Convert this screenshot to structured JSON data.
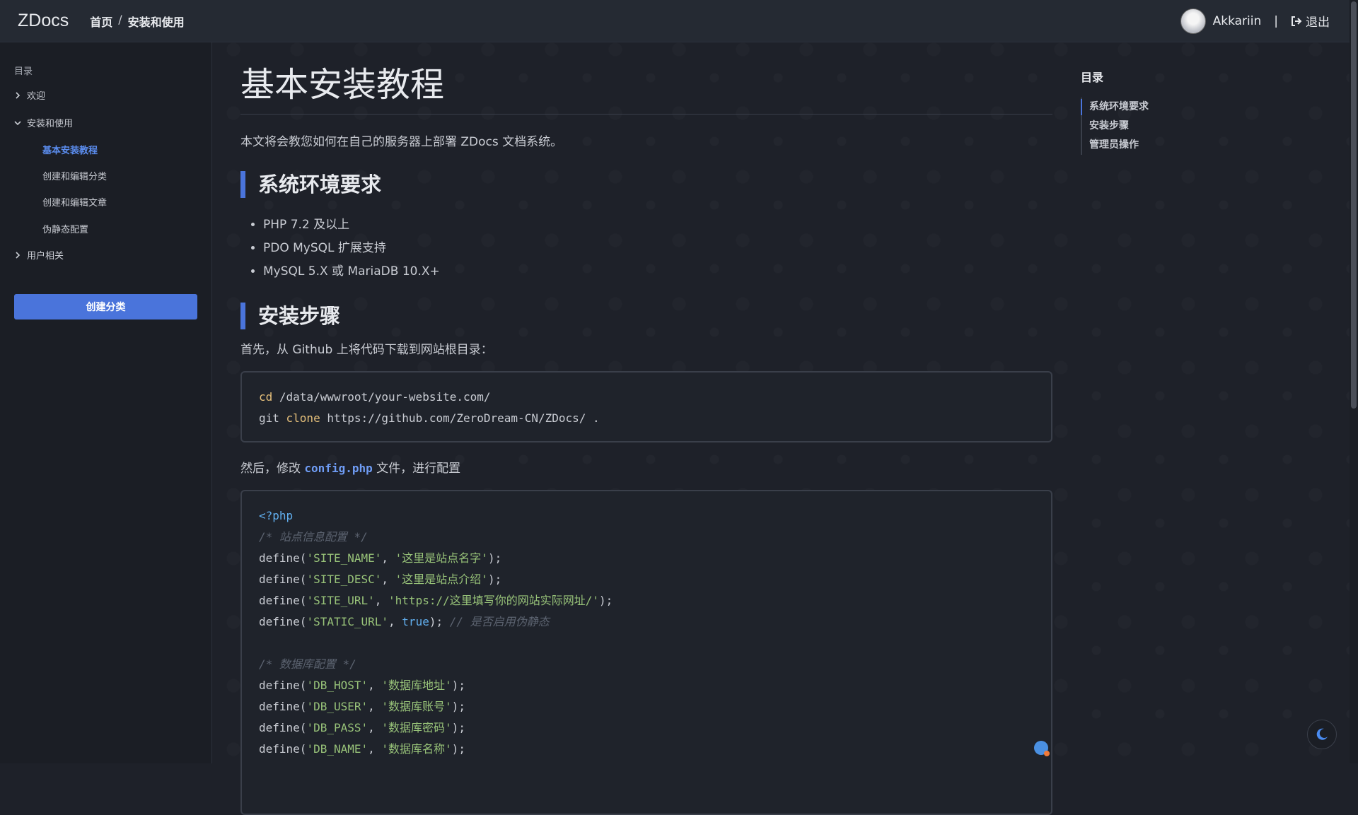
{
  "topbar": {
    "brand": "ZDocs",
    "breadcrumb": [
      "首页",
      "/",
      "安装和使用"
    ],
    "username": "Akkariin",
    "separator": "|",
    "logout_label": "退出"
  },
  "sidebar": {
    "heading": "目录",
    "items": [
      {
        "label": "欢迎",
        "expanded": false
      },
      {
        "label": "安装和使用",
        "expanded": true
      },
      {
        "label": "基本安装教程",
        "active": true
      },
      {
        "label": "创建和编辑分类"
      },
      {
        "label": "创建和编辑文章"
      },
      {
        "label": "伪静态配置"
      },
      {
        "label": "用户相关",
        "expanded": false
      }
    ],
    "create_button": "创建分类"
  },
  "main": {
    "title": "基本安装教程",
    "intro": "本文将会教您如何在自己的服务器上部署 ZDocs 文档系统。",
    "section1": "系统环境要求",
    "requirements": [
      "PHP 7.2 及以上",
      "PDO MySQL 扩展支持",
      "MySQL 5.X 或 MariaDB 10.X+"
    ],
    "section2": "安装步骤",
    "step1": "首先，从 Github 上将代码下载到网站根目录：",
    "code1": {
      "line1_cmd": "cd",
      "line1_rest": " /data/wwwroot/your-website.com/",
      "line2_git": "git ",
      "line2_cmd": "clone",
      "line2_rest": " https://github.com/ZeroDream-CN/ZDocs/ ."
    },
    "step2_pre": "然后，修改 ",
    "step2_code": "config.php",
    "step2_post": " 文件，进行配置",
    "code2": {
      "open_tag": "<?php",
      "comment_site": "/* 站点信息配置 */",
      "define": "define(",
      "sep": ", ",
      "close": ");",
      "site_name_key": "'SITE_NAME'",
      "site_name_val": "'这里是站点名字'",
      "site_desc_key": "'SITE_DESC'",
      "site_desc_val": "'这里是站点介绍'",
      "site_url_key": "'SITE_URL'",
      "site_url_val": "'https://这里填写你的网站实际网址/'",
      "static_url_key": "'STATIC_URL'",
      "static_url_val": "true",
      "static_url_close": "); ",
      "static_url_comment": "// 是否启用伪静态",
      "comment_db": "/* 数据库配置 */",
      "db_host_key": "'DB_HOST'",
      "db_host_val": "'数据库地址'",
      "db_user_key": "'DB_USER'",
      "db_user_val": "'数据库账号'",
      "db_pass_key": "'DB_PASS'",
      "db_pass_val": "'数据库密码'",
      "db_name_key": "'DB_NAME'",
      "db_name_val": "'数据库名称'"
    }
  },
  "toc": {
    "title": "目录",
    "items": [
      "系统环境要求",
      "安装步骤",
      "管理员操作"
    ]
  },
  "colors": {
    "accent": "#4a74db",
    "background": "#1e2129"
  }
}
